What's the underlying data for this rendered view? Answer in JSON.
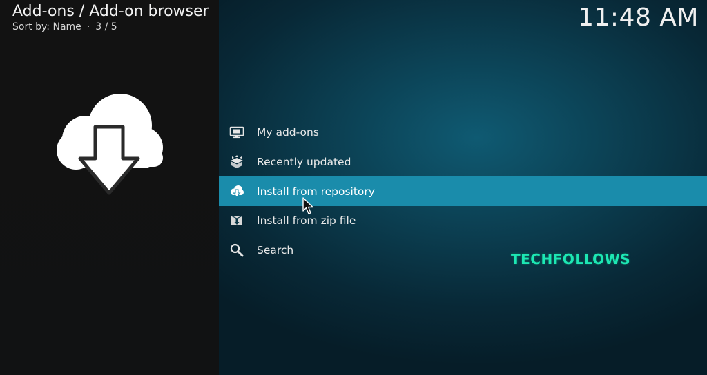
{
  "header": {
    "title": "Add-ons / Add-on browser",
    "sort_label": "Sort by: Name",
    "separator": "·",
    "position": "3 / 5"
  },
  "clock": "11:48 AM",
  "preview": {
    "icon": "cloud-download-icon"
  },
  "menu": {
    "items": [
      {
        "label": "My add-ons",
        "icon": "monitor-icon",
        "focused": false
      },
      {
        "label": "Recently updated",
        "icon": "open-box-icon",
        "focused": false
      },
      {
        "label": "Install from repository",
        "icon": "cloud-download-icon",
        "focused": true
      },
      {
        "label": "Install from zip file",
        "icon": "zip-install-icon",
        "focused": false
      },
      {
        "label": "Search",
        "icon": "search-icon",
        "focused": false
      }
    ]
  },
  "watermark": "TECHFOLLOWS",
  "colors": {
    "focus_bar": "#1a8cab",
    "watermark": "#1de7b4",
    "left_panel": "#121212"
  }
}
